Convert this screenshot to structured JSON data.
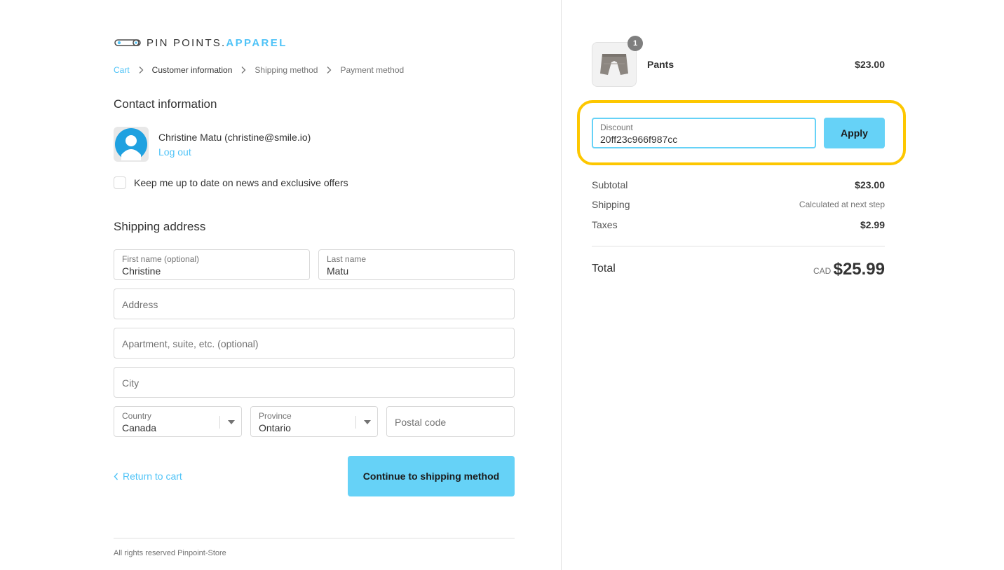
{
  "brand": {
    "name_plain": "PIN POINTS.",
    "name_accent": "APPAREL",
    "accent_color": "#4fc3f7"
  },
  "breadcrumb": {
    "cart": "Cart",
    "customer": "Customer information",
    "shipping": "Shipping method",
    "payment": "Payment method"
  },
  "contact": {
    "title": "Contact information",
    "name_line": "Christine Matu (christine@smile.io)",
    "logout": "Log out",
    "newsletter_label": "Keep me up to date on news and exclusive offers"
  },
  "shipping": {
    "title": "Shipping address",
    "first_name": {
      "label": "First name (optional)",
      "value": "Christine"
    },
    "last_name": {
      "label": "Last name",
      "value": "Matu"
    },
    "address": {
      "placeholder": "Address"
    },
    "apartment": {
      "placeholder": "Apartment, suite, etc. (optional)"
    },
    "city": {
      "placeholder": "City"
    },
    "country": {
      "label": "Country",
      "value": "Canada"
    },
    "province": {
      "label": "Province",
      "value": "Ontario"
    },
    "postal": {
      "placeholder": "Postal code"
    }
  },
  "actions": {
    "return": "Return to cart",
    "continue": "Continue to shipping method"
  },
  "footer": {
    "text": "All rights reserved Pinpoint-Store"
  },
  "order": {
    "item": {
      "name": "Pants",
      "price": "$23.00",
      "quantity": "1"
    },
    "discount": {
      "label": "Discount",
      "value": "20ff23c966f987cc",
      "apply": "Apply"
    },
    "subtotal": {
      "label": "Subtotal",
      "value": "$23.00"
    },
    "shipping": {
      "label": "Shipping",
      "value": "Calculated at next step"
    },
    "taxes": {
      "label": "Taxes",
      "value": "$2.99"
    },
    "total": {
      "label": "Total",
      "currency": "CAD",
      "value": "$25.99"
    }
  },
  "colors": {
    "button": "#66d2f7",
    "highlight": "#fdc700"
  }
}
